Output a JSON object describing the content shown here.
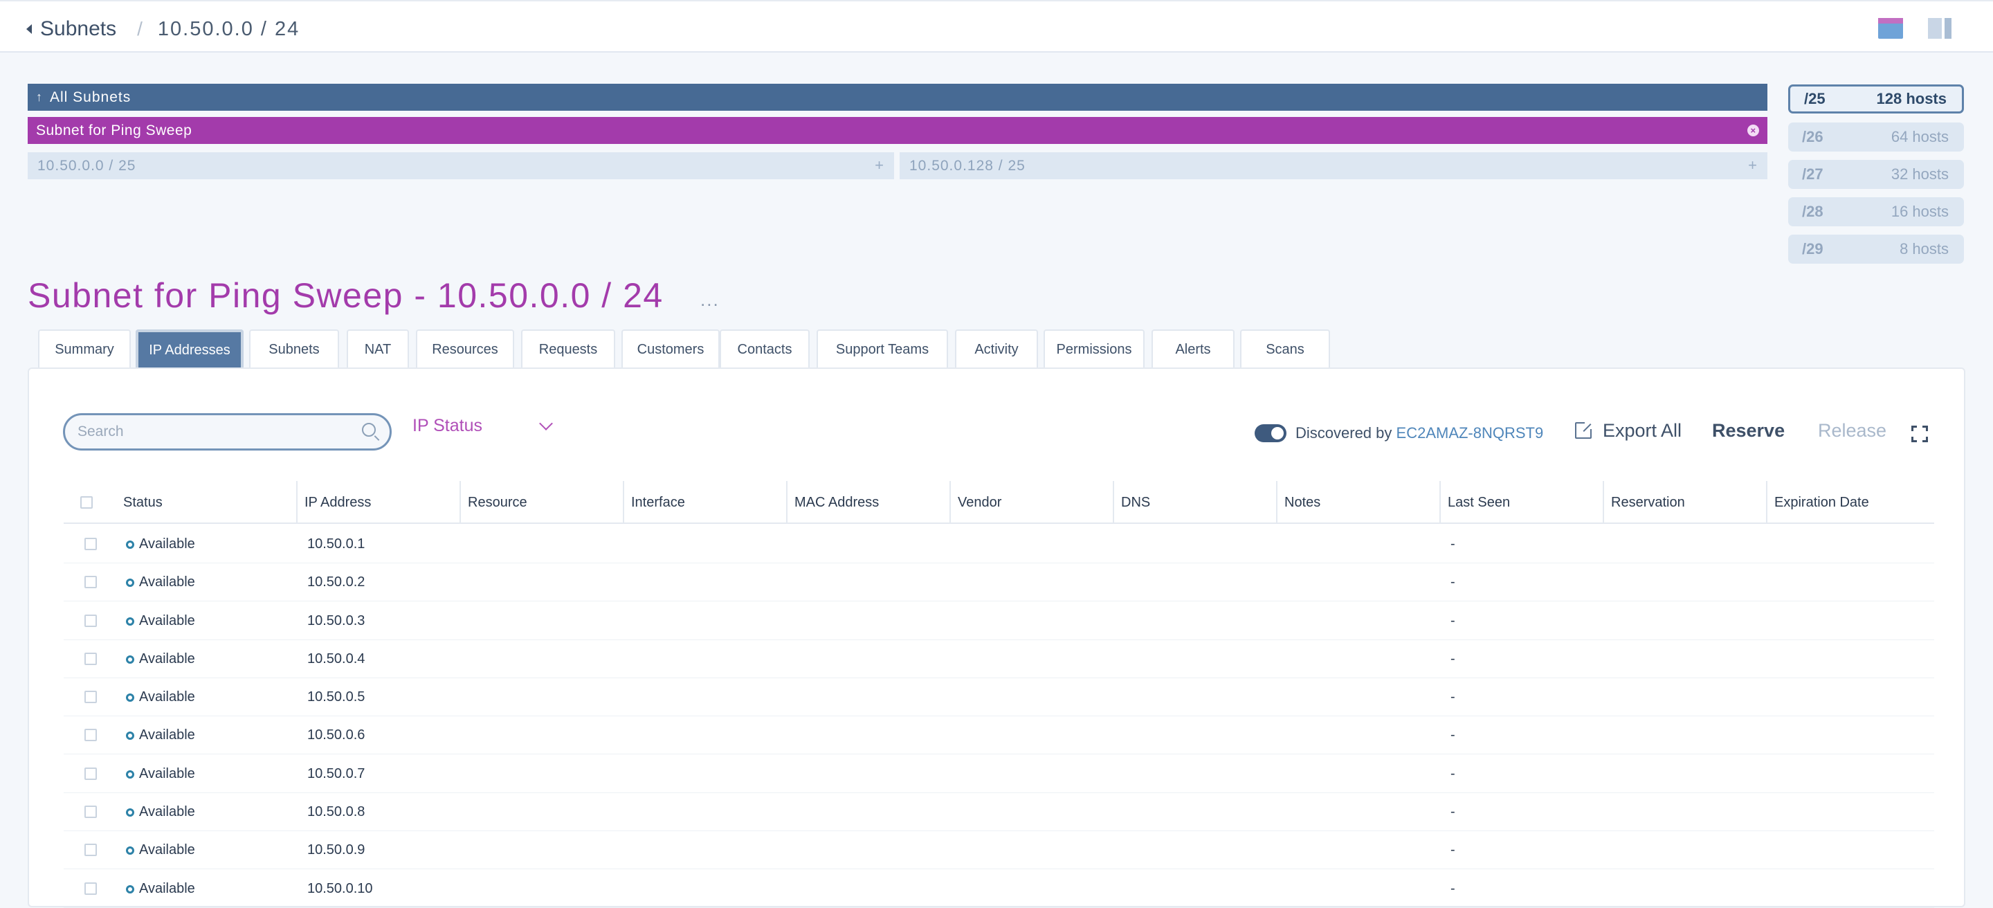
{
  "breadcrumb": {
    "parent": "Subnets",
    "separator": "/",
    "current": "10.50.0.0 / 24"
  },
  "subnet_bars": {
    "all": "All Subnets",
    "current": "Subnet for Ping Sweep",
    "children": [
      "10.50.0.0 / 25",
      "10.50.0.128 / 25"
    ]
  },
  "sizes": [
    {
      "prefix": "/25",
      "hosts": "128 hosts"
    },
    {
      "prefix": "/26",
      "hosts": "64 hosts"
    },
    {
      "prefix": "/27",
      "hosts": "32 hosts"
    },
    {
      "prefix": "/28",
      "hosts": "16 hosts"
    },
    {
      "prefix": "/29",
      "hosts": "8 hosts"
    }
  ],
  "page_title": "Subnet for Ping Sweep - 10.50.0.0 / 24",
  "more_label": "...",
  "tabs": [
    "Summary",
    "IP Addresses",
    "Subnets",
    "NAT",
    "Resources",
    "Requests",
    "Customers",
    "Contacts",
    "Support Teams",
    "Activity",
    "Permissions",
    "Alerts",
    "Scans"
  ],
  "active_tab": "IP Addresses",
  "toolbar": {
    "search_placeholder": "Search",
    "ip_status_label": "IP Status",
    "discovered_prefix": "Discovered by",
    "discovered_by": "EC2AMAZ-8NQRST9",
    "export_label": "Export All",
    "reserve_label": "Reserve",
    "release_label": "Release"
  },
  "table": {
    "columns": [
      "Status",
      "IP Address",
      "Resource",
      "Interface",
      "MAC Address",
      "Vendor",
      "DNS",
      "Notes",
      "Last Seen",
      "Reservation",
      "Expiration Date"
    ],
    "rows": [
      {
        "status": "Available",
        "ip": "10.50.0.1",
        "last_seen": "-"
      },
      {
        "status": "Available",
        "ip": "10.50.0.2",
        "last_seen": "-"
      },
      {
        "status": "Available",
        "ip": "10.50.0.3",
        "last_seen": "-"
      },
      {
        "status": "Available",
        "ip": "10.50.0.4",
        "last_seen": "-"
      },
      {
        "status": "Available",
        "ip": "10.50.0.5",
        "last_seen": "-"
      },
      {
        "status": "Available",
        "ip": "10.50.0.6",
        "last_seen": "-"
      },
      {
        "status": "Available",
        "ip": "10.50.0.7",
        "last_seen": "-"
      },
      {
        "status": "Available",
        "ip": "10.50.0.8",
        "last_seen": "-"
      },
      {
        "status": "Available",
        "ip": "10.50.0.9",
        "last_seen": "-"
      },
      {
        "status": "Available",
        "ip": "10.50.0.10",
        "last_seen": "-"
      }
    ]
  },
  "colors": {
    "brand_purple": "#A33BAB",
    "brand_blue": "#476A94",
    "status_available": "#2D82A8"
  }
}
